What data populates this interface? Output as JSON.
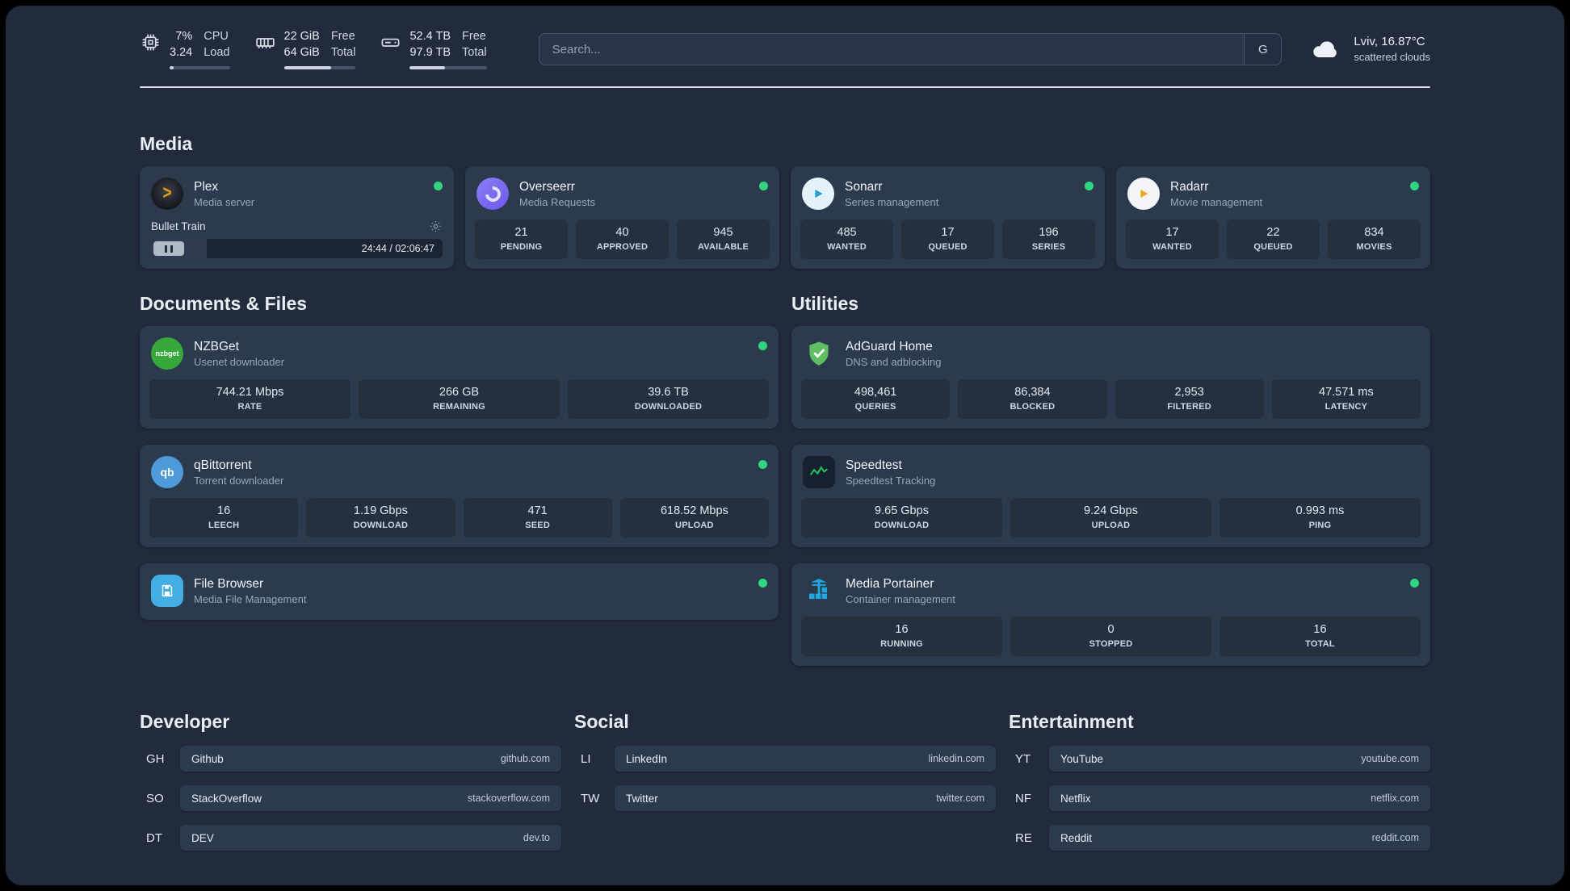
{
  "topbar": {
    "resources": {
      "cpu": {
        "value_top": "7%",
        "value_bottom": "3.24",
        "label_top": "CPU",
        "label_bottom": "Load",
        "percent": 7
      },
      "memory": {
        "value_top": "22 GiB",
        "value_bottom": "64 GiB",
        "label_top": "Free",
        "label_bottom": "Total",
        "percent": 66
      },
      "disk": {
        "value_top": "52.4 TB",
        "value_bottom": "97.9 TB",
        "label_top": "Free",
        "label_bottom": "Total",
        "percent": 46
      }
    },
    "search": {
      "placeholder": "Search...",
      "button_label": "G"
    },
    "weather": {
      "location": "Lviv, 16.87°C",
      "condition": "scattered clouds"
    }
  },
  "sections": {
    "media": {
      "title": "Media",
      "plex": {
        "name": "Plex",
        "subtitle": "Media server",
        "now_playing": "Bullet Train",
        "time": "24:44 / 02:06:47",
        "progress_percent": 19
      },
      "overseerr": {
        "name": "Overseerr",
        "subtitle": "Media Requests",
        "stats": [
          {
            "value": "21",
            "label": "PENDING"
          },
          {
            "value": "40",
            "label": "APPROVED"
          },
          {
            "value": "945",
            "label": "AVAILABLE"
          }
        ]
      },
      "sonarr": {
        "name": "Sonarr",
        "subtitle": "Series management",
        "stats": [
          {
            "value": "485",
            "label": "WANTED"
          },
          {
            "value": "17",
            "label": "QUEUED"
          },
          {
            "value": "196",
            "label": "SERIES"
          }
        ]
      },
      "radarr": {
        "name": "Radarr",
        "subtitle": "Movie management",
        "stats": [
          {
            "value": "17",
            "label": "WANTED"
          },
          {
            "value": "22",
            "label": "QUEUED"
          },
          {
            "value": "834",
            "label": "MOVIES"
          }
        ]
      }
    },
    "documents": {
      "title": "Documents & Files",
      "nzbget": {
        "name": "NZBGet",
        "subtitle": "Usenet downloader",
        "icon_text": "nzbget",
        "stats": [
          {
            "value": "744.21 Mbps",
            "label": "RATE"
          },
          {
            "value": "266 GB",
            "label": "REMAINING"
          },
          {
            "value": "39.6 TB",
            "label": "DOWNLOADED"
          }
        ]
      },
      "qbittorrent": {
        "name": "qBittorrent",
        "subtitle": "Torrent downloader",
        "icon_text": "qb",
        "stats": [
          {
            "value": "16",
            "label": "LEECH"
          },
          {
            "value": "1.19 Gbps",
            "label": "DOWNLOAD"
          },
          {
            "value": "471",
            "label": "SEED"
          },
          {
            "value": "618.52 Mbps",
            "label": "UPLOAD"
          }
        ]
      },
      "filebrowser": {
        "name": "File Browser",
        "subtitle": "Media File Management"
      }
    },
    "utilities": {
      "title": "Utilities",
      "adguard": {
        "name": "AdGuard Home",
        "subtitle": "DNS and adblocking",
        "stats": [
          {
            "value": "498,461",
            "label": "QUERIES"
          },
          {
            "value": "86,384",
            "label": "BLOCKED"
          },
          {
            "value": "2,953",
            "label": "FILTERED"
          },
          {
            "value": "47.571 ms",
            "label": "LATENCY"
          }
        ]
      },
      "speedtest": {
        "name": "Speedtest",
        "subtitle": "Speedtest Tracking",
        "stats": [
          {
            "value": "9.65 Gbps",
            "label": "DOWNLOAD"
          },
          {
            "value": "9.24 Gbps",
            "label": "UPLOAD"
          },
          {
            "value": "0.993 ms",
            "label": "PING"
          }
        ]
      },
      "portainer": {
        "name": "Media Portainer",
        "subtitle": "Container management",
        "stats": [
          {
            "value": "16",
            "label": "RUNNING"
          },
          {
            "value": "0",
            "label": "STOPPED"
          },
          {
            "value": "16",
            "label": "TOTAL"
          }
        ]
      }
    }
  },
  "bookmarks": [
    {
      "title": "Developer",
      "items": [
        {
          "abbr": "GH",
          "name": "Github",
          "domain": "github.com"
        },
        {
          "abbr": "SO",
          "name": "StackOverflow",
          "domain": "stackoverflow.com"
        },
        {
          "abbr": "DT",
          "name": "DEV",
          "domain": "dev.to"
        }
      ]
    },
    {
      "title": "Social",
      "items": [
        {
          "abbr": "LI",
          "name": "LinkedIn",
          "domain": "linkedin.com"
        },
        {
          "abbr": "TW",
          "name": "Twitter",
          "domain": "twitter.com"
        }
      ]
    },
    {
      "title": "Entertainment",
      "items": [
        {
          "abbr": "YT",
          "name": "YouTube",
          "domain": "youtube.com"
        },
        {
          "abbr": "NF",
          "name": "Netflix",
          "domain": "netflix.com"
        },
        {
          "abbr": "RE",
          "name": "Reddit",
          "domain": "reddit.com"
        }
      ]
    }
  ],
  "colors": {
    "status_online": "#2fd57f"
  }
}
